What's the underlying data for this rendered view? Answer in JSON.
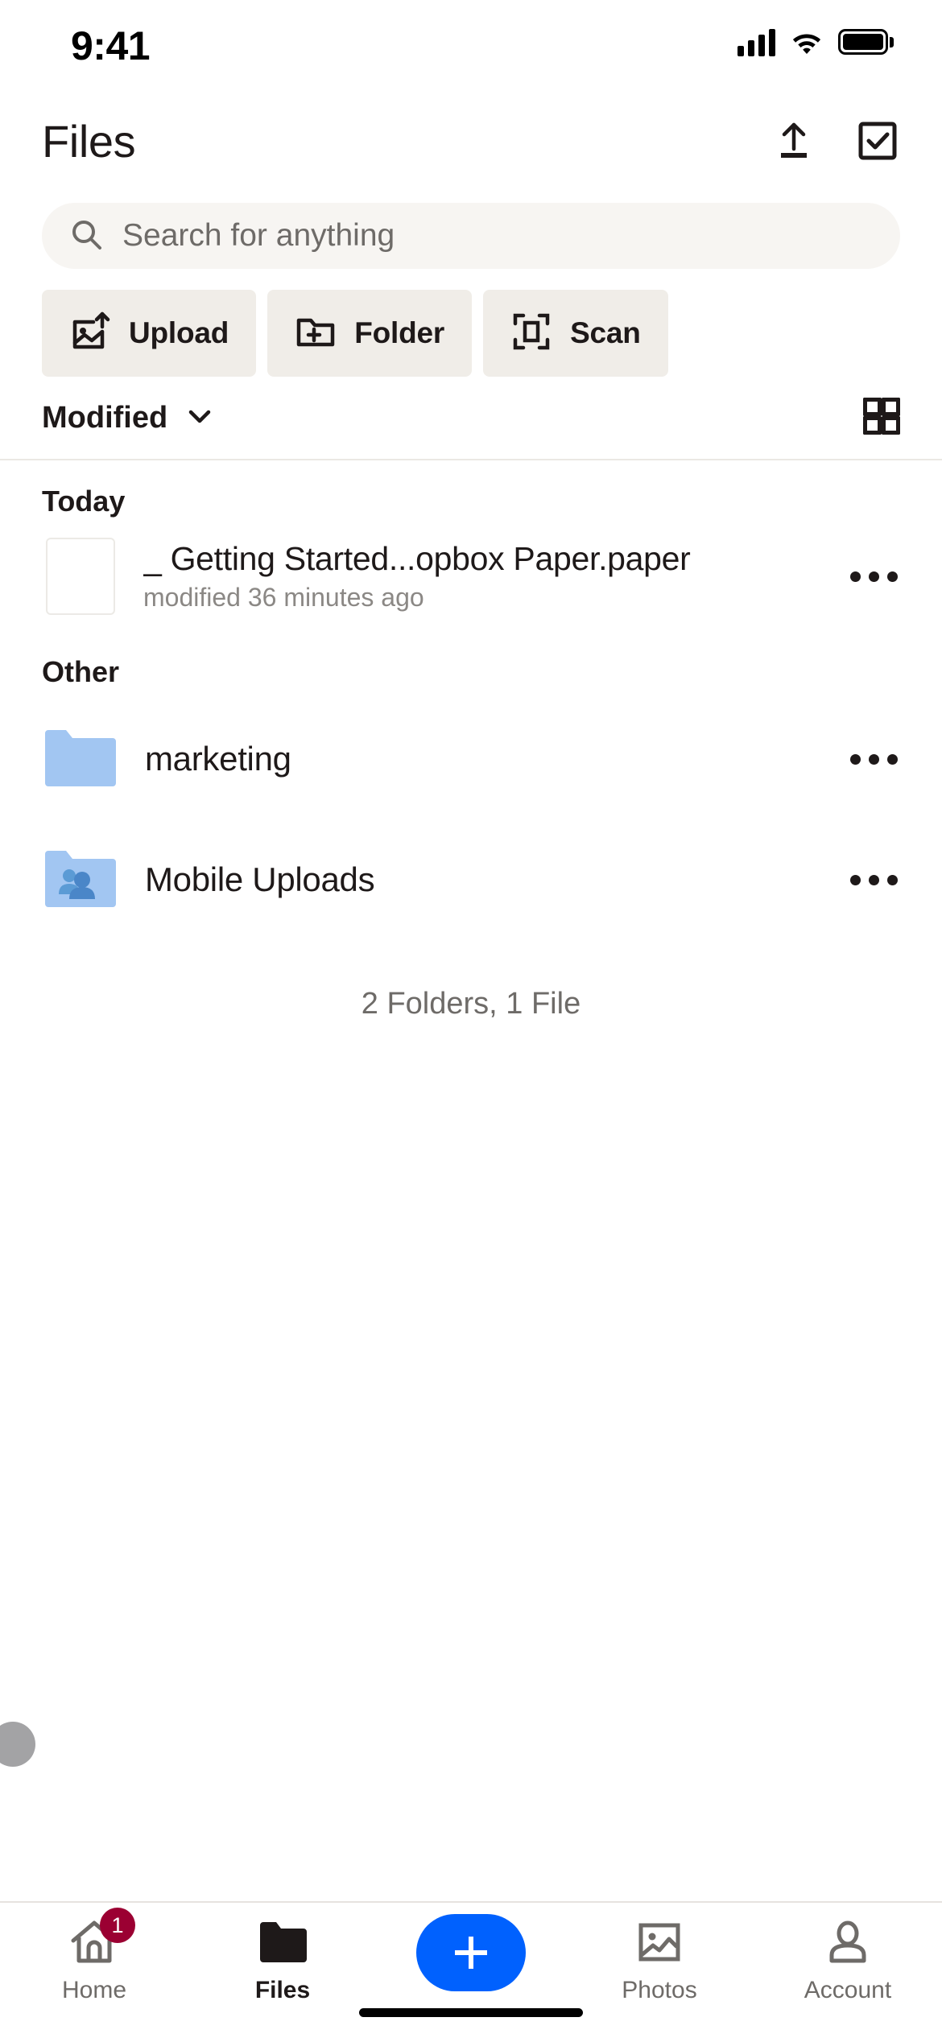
{
  "status_bar": {
    "time": "9:41",
    "cellular_icon": "signal-bars-icon",
    "wifi_icon": "wifi-icon",
    "battery_icon": "battery-full-icon"
  },
  "header": {
    "title": "Files",
    "upload_icon": "upload-arrow-icon",
    "select_icon": "checkbox-select-icon"
  },
  "search": {
    "placeholder": "Search for anything",
    "icon": "search-icon"
  },
  "quick_actions": [
    {
      "label": "Upload",
      "icon": "image-upload-icon"
    },
    {
      "label": "Folder",
      "icon": "folder-plus-icon"
    },
    {
      "label": "Scan",
      "icon": "scan-frame-icon"
    }
  ],
  "sort": {
    "label": "Modified",
    "chevron_icon": "chevron-down-icon",
    "view_toggle_icon": "grid-view-icon"
  },
  "sections": [
    {
      "title": "Today",
      "items": [
        {
          "name": "_ Getting Started...opbox Paper.paper",
          "subtitle": "modified 36 minutes ago",
          "icon": "paper-document-thumbnail",
          "more_icon": "more-options-icon"
        }
      ]
    },
    {
      "title": "Other",
      "items": [
        {
          "name": "marketing",
          "subtitle": "",
          "icon": "folder-icon",
          "more_icon": "more-options-icon"
        },
        {
          "name": "Mobile Uploads",
          "subtitle": "",
          "icon": "shared-folder-icon",
          "more_icon": "more-options-icon"
        }
      ]
    }
  ],
  "footer_count": "2 Folders, 1 File",
  "tabs": [
    {
      "label": "Home",
      "icon": "home-icon",
      "badge": "1",
      "active": false
    },
    {
      "label": "Files",
      "icon": "folder-filled-icon",
      "badge": "",
      "active": true
    },
    {
      "label": "",
      "icon": "plus-icon",
      "badge": "",
      "active": false
    },
    {
      "label": "Photos",
      "icon": "photos-icon",
      "badge": "",
      "active": false
    },
    {
      "label": "Account",
      "icon": "person-icon",
      "badge": "",
      "active": false
    }
  ],
  "colors": {
    "accent_blue": "#0061fe",
    "badge_red": "#9b0032",
    "folder_blue": "#a2c6f2",
    "chip_bg": "#f0ede8",
    "search_bg": "#f7f5f2",
    "text_primary": "#1e1919",
    "text_secondary": "#6e6b68"
  }
}
